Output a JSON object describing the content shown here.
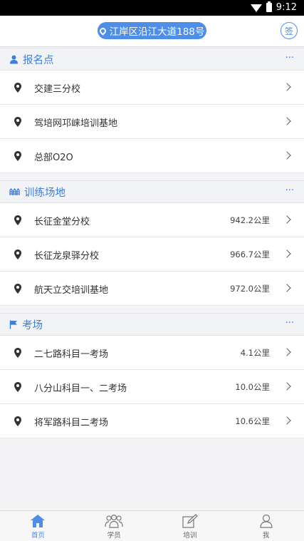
{
  "status_bar": {
    "time": "9:12"
  },
  "header": {
    "location": "江岸区沿江大道188号",
    "sign_label": "签"
  },
  "sections": [
    {
      "title": "报名点",
      "more": "···",
      "items": [
        {
          "name": "交建三分校",
          "distance": ""
        },
        {
          "name": "驾培网邛崃培训基地",
          "distance": ""
        },
        {
          "name": "总部O2O",
          "distance": ""
        }
      ]
    },
    {
      "title": "训练场地",
      "more": "···",
      "items": [
        {
          "name": "长征金堂分校",
          "distance": "942.2公里"
        },
        {
          "name": "长征龙泉驿分校",
          "distance": "966.7公里"
        },
        {
          "name": "航天立交培训基地",
          "distance": "972.0公里"
        }
      ]
    },
    {
      "title": "考场",
      "more": "···",
      "items": [
        {
          "name": "二七路科目一考场",
          "distance": "4.1公里"
        },
        {
          "name": "八分山科目一、二考场",
          "distance": "10.0公里"
        },
        {
          "name": "将军路科目二考场",
          "distance": "10.6公里"
        }
      ]
    }
  ],
  "bottom_nav": [
    {
      "label": "首页",
      "active": true
    },
    {
      "label": "学员",
      "active": false
    },
    {
      "label": "培训",
      "active": false
    },
    {
      "label": "我",
      "active": false
    }
  ],
  "colors": {
    "accent": "#4e8ee6",
    "section_title": "#3e7fd6"
  }
}
